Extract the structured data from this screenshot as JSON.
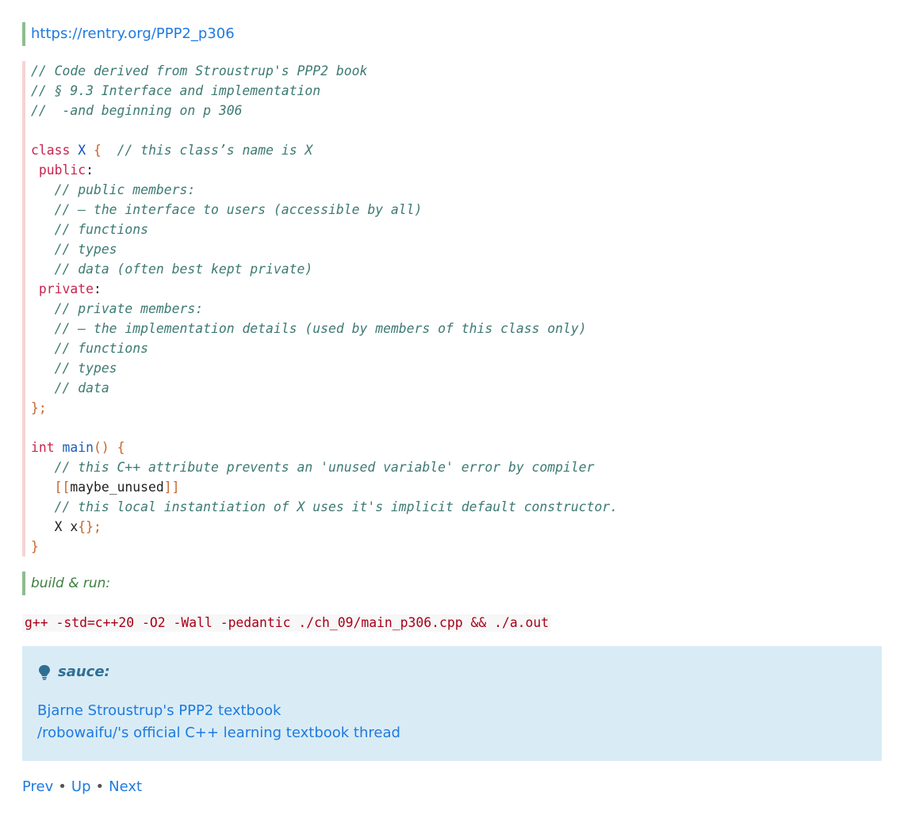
{
  "header_link": "https://rentry.org/PPP2_p306",
  "code": {
    "line1": "// Code derived from Stroustrup's PPP2 book",
    "line2": "// § 9.3 Interface and implementation",
    "line3": "//  -and beginning on p 306",
    "class_kw": "class",
    "class_name": "X",
    "class_comment": "// this class’s name is X",
    "public_kw": "public",
    "pub_c1": "// public members:",
    "pub_c2": "// – the interface to users (accessible by all)",
    "pub_c3": "// functions",
    "pub_c4": "// types",
    "pub_c5": "// data (often best kept private)",
    "private_kw": "private",
    "priv_c1": "// private members:",
    "priv_c2": "// – the implementation details (used by members of this class only)",
    "priv_c3": "// functions",
    "priv_c4": "// types",
    "priv_c5": "// data",
    "int_kw": "int",
    "main_fn": "main",
    "main_c1": "// this C++ attribute prevents an 'unused variable' error by compiler",
    "attr": "maybe_unused",
    "main_c2": "// this local instantiation of X uses it's implicit default constructor.",
    "decl": "X x"
  },
  "build_label": "build & run:",
  "command": "g++ -std=c++20 -O2 -Wall -pedantic ./ch_09/main_p306.cpp && ./a.out",
  "note": {
    "icon": "lightbulb-icon",
    "title": "sauce:",
    "links": [
      "Bjarne Stroustrup's PPP2 textbook",
      "/robowaifu/'s official C++ learning textbook thread"
    ]
  },
  "nav": {
    "prev": "Prev",
    "up": "Up",
    "next": "Next",
    "separator": "•"
  },
  "colors": {
    "link": "#1f7ae0",
    "note_bg": "#d9ecf5",
    "note_title": "#2f6f94",
    "comment": "#3d7a73",
    "keyword": "#c7254e",
    "command": "#a80018"
  }
}
